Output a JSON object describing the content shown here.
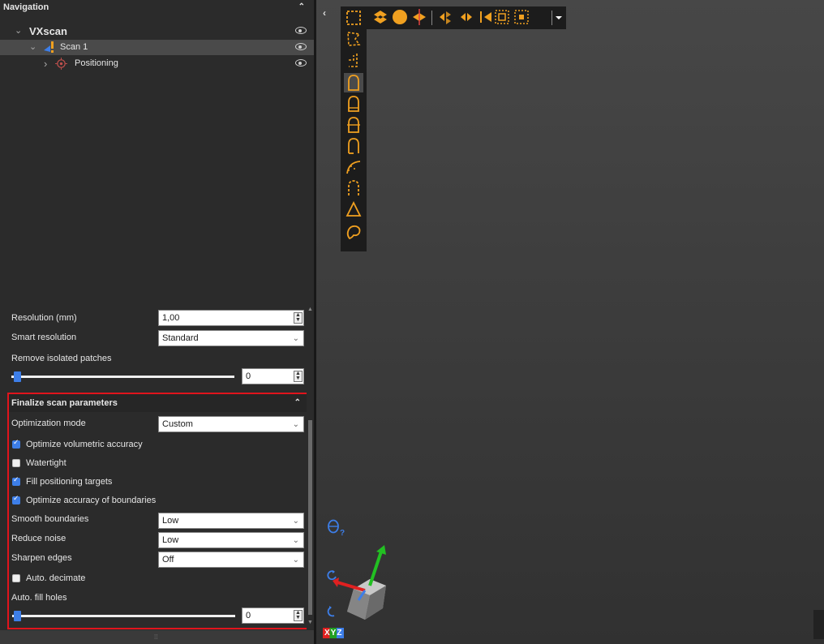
{
  "navigation": {
    "header": "Navigation",
    "tree": [
      {
        "label": "VXscan",
        "expand": "⌄"
      },
      {
        "label": "Scan 1",
        "expand": "⌄"
      },
      {
        "label": "Positioning",
        "expand": "›"
      }
    ]
  },
  "scan_params": {
    "resolution_label": "Resolution (mm)",
    "resolution_value": "1,00",
    "smart_resolution_label": "Smart resolution",
    "smart_resolution_value": "Standard",
    "remove_patches_label": "Remove isolated patches",
    "remove_patches_value": "0",
    "remove_patches_level": 0
  },
  "finalize": {
    "header": "Finalize scan parameters",
    "optimization_mode_label": "Optimization mode",
    "optimization_mode_value": "Custom",
    "checkboxes": [
      {
        "label": "Optimize volumetric accuracy",
        "checked": true
      },
      {
        "label": "Watertight",
        "checked": false
      },
      {
        "label": "Fill positioning targets",
        "checked": true
      },
      {
        "label": "Optimize accuracy of boundaries",
        "checked": true
      }
    ],
    "smooth_boundaries_label": "Smooth boundaries",
    "smooth_boundaries_value": "Low",
    "reduce_noise_label": "Reduce noise",
    "reduce_noise_value": "Low",
    "sharpen_edges_label": "Sharpen edges",
    "sharpen_edges_value": "Off",
    "auto_decimate_label": "Auto. decimate",
    "auto_decimate_checked": false,
    "auto_fill_holes_label": "Auto. fill holes",
    "auto_fill_holes_value": "0",
    "auto_fill_holes_level": 0
  },
  "viewport": {
    "axis_label": "XYZ",
    "mouse_help": "?"
  },
  "colors": {
    "accent_orange": "#f0a020",
    "highlight_red": "#e0141c",
    "checkbox_blue": "#3d7ee8"
  }
}
